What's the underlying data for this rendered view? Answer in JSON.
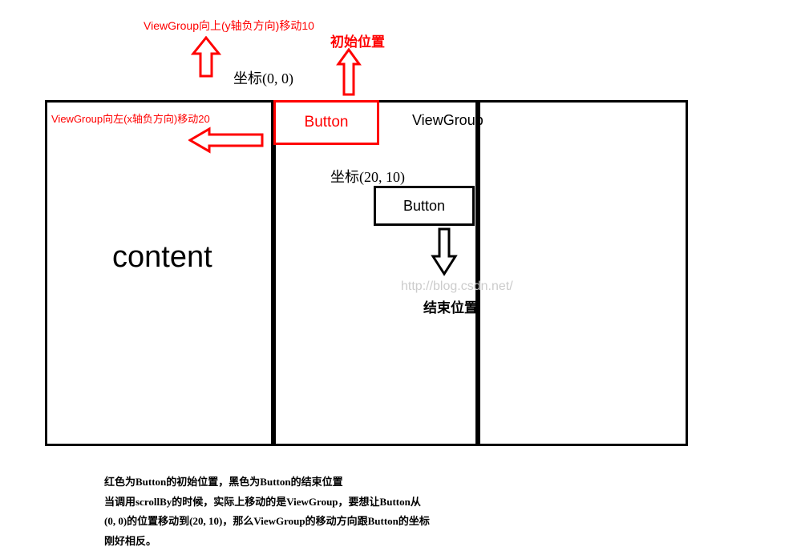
{
  "annotations": {
    "topRed": "ViewGroup向上(y轴负方向)移动10",
    "initialPos": "初始位置",
    "coord00": "坐标(0, 0)",
    "leftRed": "ViewGroup向左(x轴负方向)移动20",
    "buttonRed": "Button",
    "viewGroup": "ViewGroup",
    "coord2010": "坐标(20, 10)",
    "buttonBlack": "Button",
    "content": "content",
    "endPos": "结束位置"
  },
  "watermark": "http://blog.csdn.net/",
  "description": {
    "line1": "红色为Button的初始位置，黑色为Button的结束位置",
    "line2": "当调用scrollBy的时候，实际上移动的是ViewGroup，要想让Button从",
    "line3": "(0, 0)的位置移动到(20, 10)，那么ViewGroup的移动方向跟Button的坐标",
    "line4": "刚好相反。"
  }
}
